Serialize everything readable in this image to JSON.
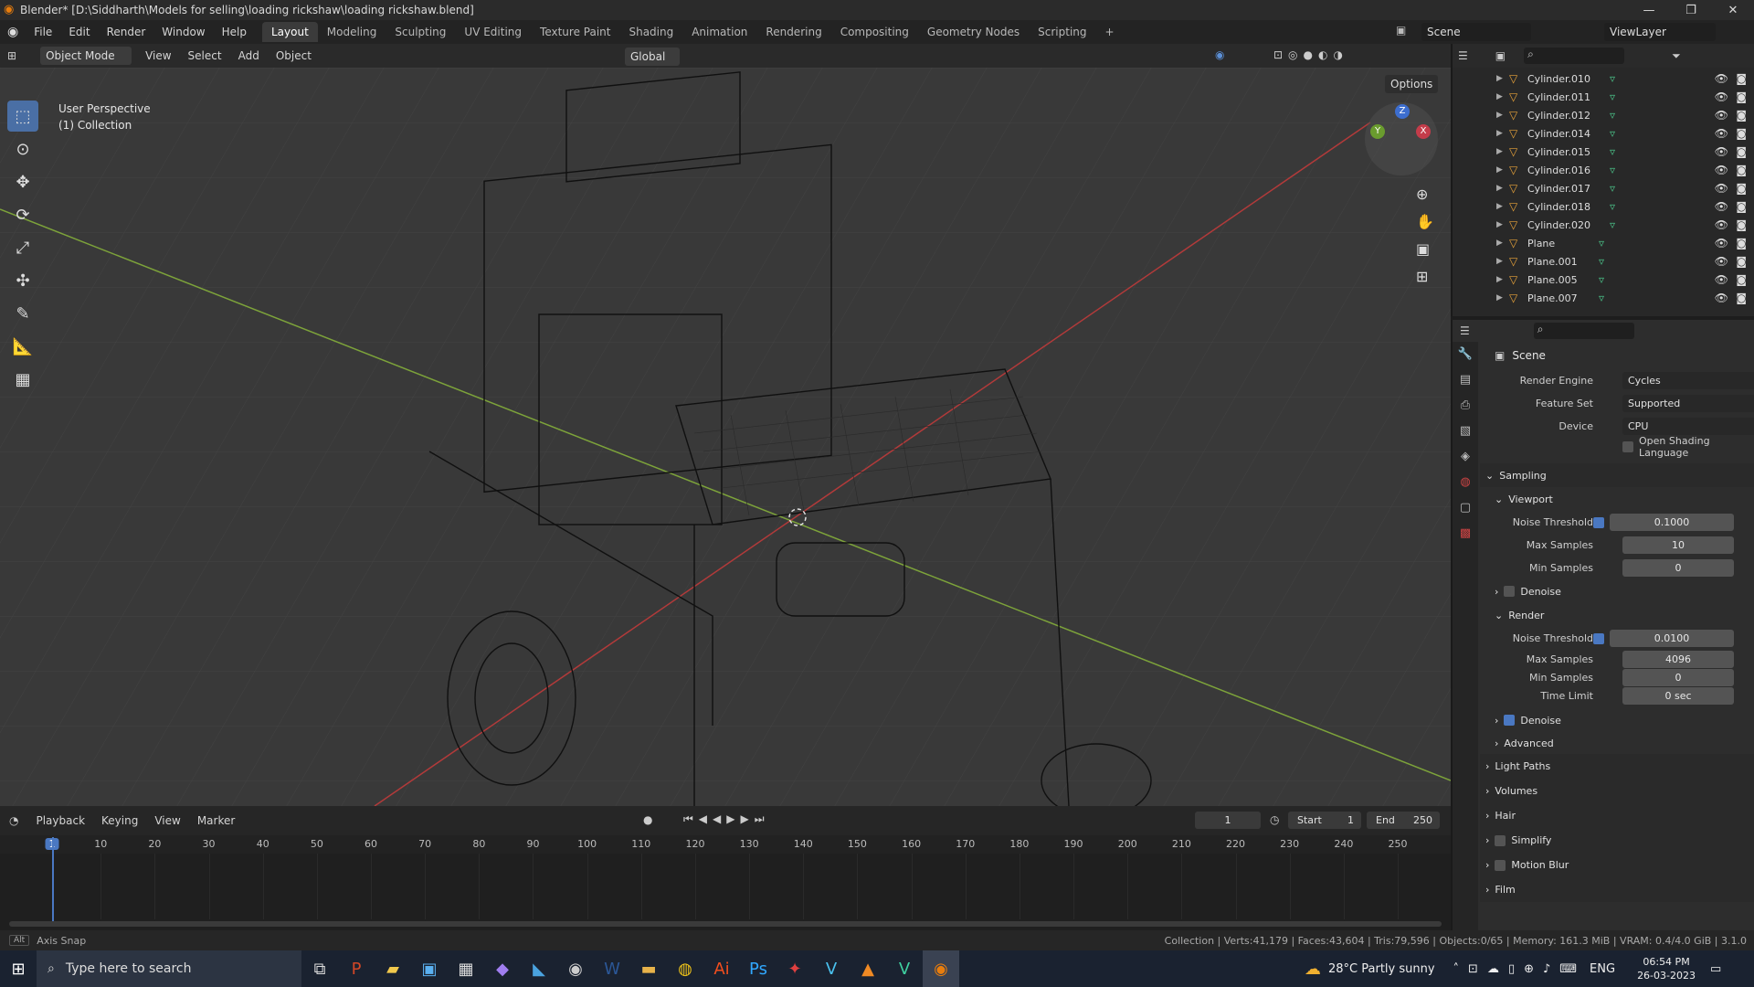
{
  "window": {
    "title": "Blender* [D:\\Siddharth\\Models for selling\\loading rickshaw\\loading rickshaw.blend]",
    "min": "—",
    "max": "❐",
    "close": "✕"
  },
  "menu": [
    "File",
    "Edit",
    "Render",
    "Window",
    "Help"
  ],
  "workspaces": [
    "Layout",
    "Modeling",
    "Sculpting",
    "UV Editing",
    "Texture Paint",
    "Shading",
    "Animation",
    "Rendering",
    "Compositing",
    "Geometry Nodes",
    "Scripting",
    "+"
  ],
  "active_workspace": "Layout",
  "scene_field": "Scene",
  "viewlayer_field": "ViewLayer",
  "viewport_header": {
    "mode": "Object Mode",
    "menus": [
      "View",
      "Select",
      "Add",
      "Object"
    ],
    "orientation": "Global",
    "options": "Options"
  },
  "viewport": {
    "perspective": "User Perspective",
    "collection": "(1) Collection"
  },
  "gizmo": {
    "z": "Z",
    "y": "Y",
    "x": "X"
  },
  "outliner": {
    "items": [
      "Cylinder.010",
      "Cylinder.011",
      "Cylinder.012",
      "Cylinder.014",
      "Cylinder.015",
      "Cylinder.016",
      "Cylinder.017",
      "Cylinder.018",
      "Cylinder.020",
      "Plane",
      "Plane.001",
      "Plane.005",
      "Plane.007"
    ]
  },
  "properties": {
    "context": "Scene",
    "render_engine_label": "Render Engine",
    "render_engine": "Cycles",
    "feature_set_label": "Feature Set",
    "feature_set": "Supported",
    "device_label": "Device",
    "device": "CPU",
    "osl_label": "Open Shading Language",
    "sampling": "Sampling",
    "viewport": "Viewport",
    "vp_noise_label": "Noise Threshold",
    "vp_noise": "0.1000",
    "vp_max_label": "Max Samples",
    "vp_max": "10",
    "vp_min_label": "Min Samples",
    "vp_min": "0",
    "vp_denoise": "Denoise",
    "render": "Render",
    "r_noise_label": "Noise Threshold",
    "r_noise": "0.0100",
    "r_max_label": "Max Samples",
    "r_max": "4096",
    "r_min_label": "Min Samples",
    "r_min": "0",
    "time_limit_label": "Time Limit",
    "time_limit": "0 sec",
    "r_denoise": "Denoise",
    "advanced": "Advanced",
    "light_paths": "Light Paths",
    "volumes": "Volumes",
    "hair": "Hair",
    "simplify": "Simplify",
    "motion_blur": "Motion Blur",
    "film": "Film"
  },
  "timeline": {
    "menus": [
      "Playback",
      "Keying",
      "View",
      "Marker"
    ],
    "current_frame": "1",
    "start_label": "Start",
    "start": "1",
    "end_label": "End",
    "end": "250",
    "ticks": [
      "1",
      "10",
      "20",
      "30",
      "40",
      "50",
      "60",
      "70",
      "80",
      "90",
      "100",
      "110",
      "120",
      "130",
      "140",
      "150",
      "160",
      "170",
      "180",
      "190",
      "200",
      "210",
      "220",
      "230",
      "240",
      "250"
    ]
  },
  "statusbar": {
    "hint": "Axis Snap",
    "stats": "Collection | Verts:41,179 | Faces:43,604 | Tris:79,596 | Objects:0/65 | Memory: 161.3 MiB | VRAM: 0.4/4.0 GiB | 3.1.0"
  },
  "taskbar": {
    "search_placeholder": "Type here to search",
    "weather": "28°C  Partly sunny",
    "lang": "ENG",
    "time": "06:54 PM",
    "date": "26-03-2023"
  }
}
